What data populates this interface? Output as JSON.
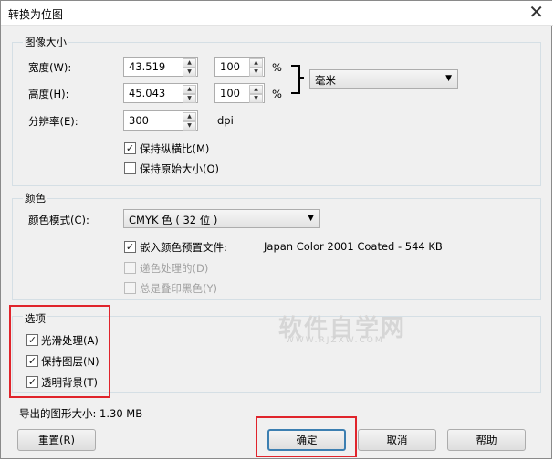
{
  "window": {
    "title": "转换为位图",
    "close_glyph": "✕"
  },
  "image_size": {
    "group_label": "图像大小",
    "width_label": "宽度(W):",
    "width_value": "43.519",
    "width_percent": "100",
    "height_label": "高度(H):",
    "height_value": "45.043",
    "height_percent": "100",
    "percent_symbol": "%",
    "unit_value": "毫米",
    "resolution_label": "分辨率(E):",
    "resolution_value": "300",
    "resolution_unit": "dpi",
    "keep_aspect_label": "保持纵横比(M)",
    "keep_aspect_checked": true,
    "keep_original_label": "保持原始大小(O)",
    "keep_original_checked": false
  },
  "color": {
    "group_label": "颜色",
    "mode_label": "颜色模式(C):",
    "mode_value": "CMYK 色 ( 32 位 )",
    "embed_profile_label": "嵌入颜色预置文件:",
    "embed_profile_checked": true,
    "profile_name": "Japan Color 2001 Coated - 544 KB",
    "dither_label": "递色处理的(D)",
    "dither_checked": false,
    "overprint_label": "总是叠印黑色(Y)",
    "overprint_checked": false
  },
  "options": {
    "group_label": "选项",
    "antialias_label": "光滑处理(A)",
    "antialias_checked": true,
    "keep_layers_label": "保持图层(N)",
    "keep_layers_checked": true,
    "transparent_label": "透明背景(T)",
    "transparent_checked": true
  },
  "export_size": "导出的图形大小: 1.30 MB",
  "buttons": {
    "reset": "重置(R)",
    "ok": "确定",
    "cancel": "取消",
    "help": "帮助"
  },
  "watermark": {
    "main": "软件自学网",
    "sub": "WWW.RJZXW.COM"
  },
  "icons": {
    "spin_up": "▲",
    "spin_down": "▼",
    "dropdown": "▼",
    "check": "✓"
  },
  "colors": {
    "highlight_red": "#e0242b",
    "default_button_border": "#3c7fb1"
  }
}
